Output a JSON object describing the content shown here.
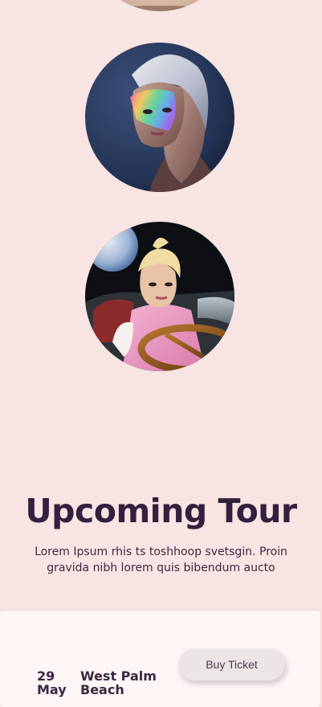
{
  "tour": {
    "heading": "Upcoming Tour",
    "description": "Lorem Ipsum rhis ts toshhoop svetsgin. Proin gravida nibh lorem quis bibendum aucto",
    "events": [
      {
        "date_line1": "29",
        "date_line2": "May",
        "city_line1": "West Palm",
        "city_line2": "Beach",
        "button_label": "Buy Ticket"
      }
    ]
  },
  "colors": {
    "page_background": "#f8e4e2",
    "heading": "#33203f",
    "card_background": "#fdf6f5",
    "button_background": "#ebe6e5"
  }
}
